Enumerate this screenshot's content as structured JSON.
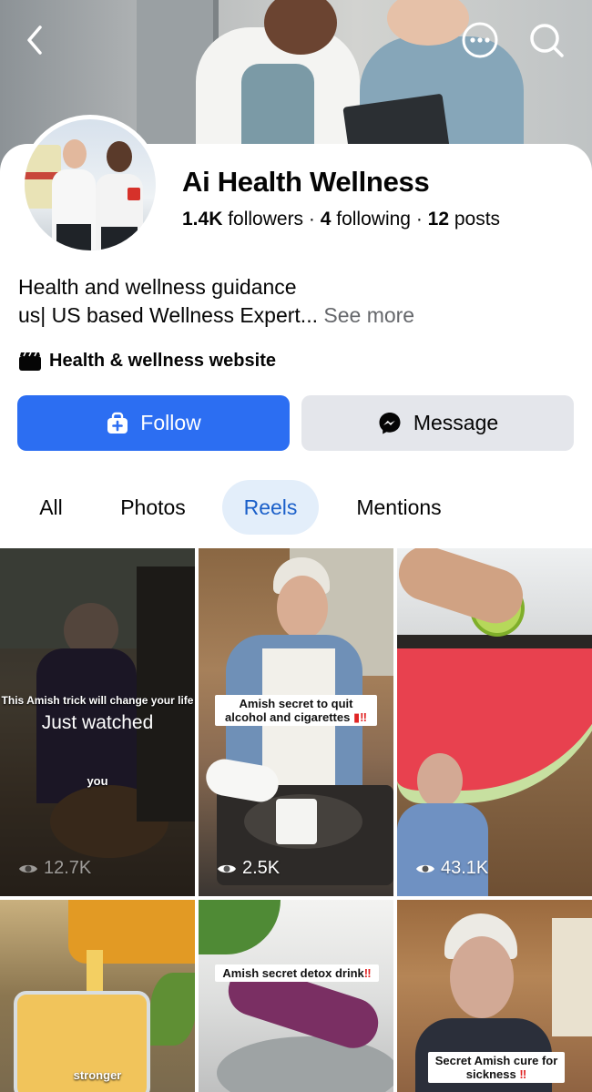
{
  "profile": {
    "name": "Ai Health Wellness",
    "followers_count": "1.4K",
    "followers_label": " followers",
    "following_count": "4",
    "following_label": " following",
    "posts_count": "12",
    "posts_label": " posts",
    "separator": " · ",
    "bio_line1": "Health and wellness guidance",
    "bio_line2": "us| US based Wellness Expert...",
    "see_more": "See more",
    "category": "Health & wellness website"
  },
  "buttons": {
    "follow": "Follow",
    "message": "Message"
  },
  "tabs": [
    {
      "label": "All"
    },
    {
      "label": "Photos"
    },
    {
      "label": "Reels"
    },
    {
      "label": "Mentions"
    }
  ],
  "active_tab": "Reels",
  "reels": [
    {
      "caption": "This Amish trick will change your life",
      "status": "Just watched",
      "subtext": "you",
      "views": "12.7K"
    },
    {
      "caption": "Amish secret to quit alcohol and cigarettes",
      "views": "2.5K"
    },
    {
      "caption": "",
      "views": "43.1K"
    },
    {
      "caption": "",
      "subtext": "stronger",
      "views": ""
    },
    {
      "caption": "Amish secret detox drink",
      "views": ""
    },
    {
      "caption": "Secret Amish cure for sickness",
      "views": ""
    }
  ],
  "icons": {
    "back": "chevron-left-icon",
    "more": "more-horizontal-icon",
    "search": "search-icon",
    "category": "clapperboard-icon",
    "follow": "add-bag-icon",
    "message": "messenger-icon",
    "views": "eye-icon"
  },
  "colors": {
    "accent": "#2c6ef2",
    "tab_active_bg": "#e3eefa",
    "tab_active_text": "#1a5fc9",
    "secondary_button": "#e4e6eb",
    "muted_text": "#65676b",
    "alert_red": "#e02424"
  }
}
